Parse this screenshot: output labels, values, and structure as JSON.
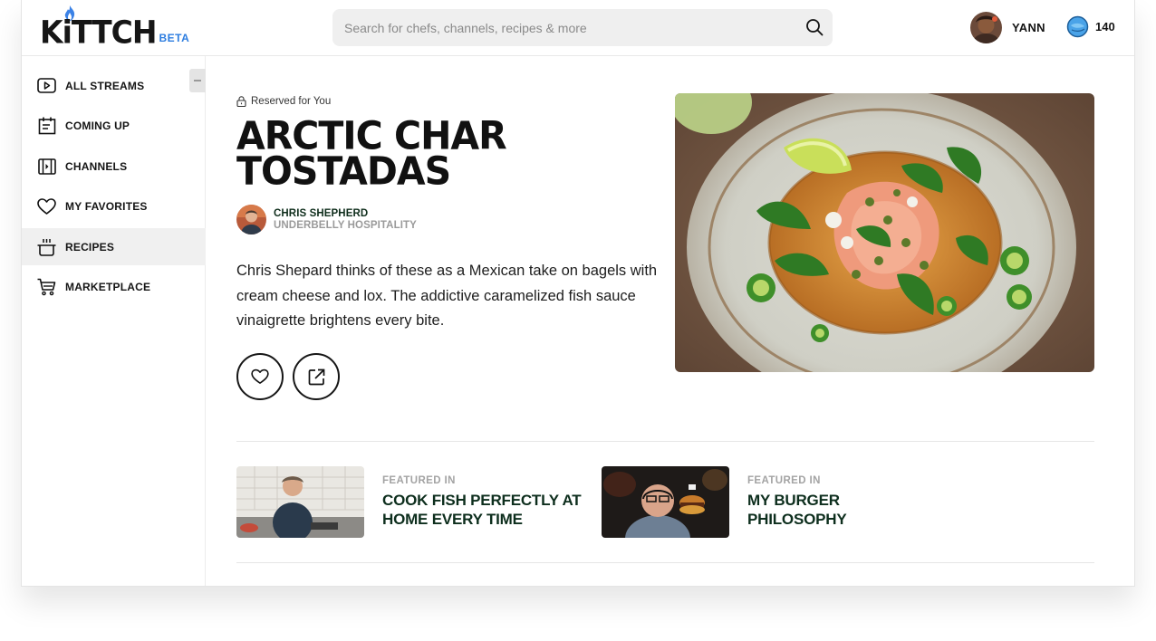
{
  "brand": {
    "name": "KiTTCH",
    "badge": "BETA"
  },
  "search": {
    "placeholder": "Search for chefs, channels, recipes & more",
    "icon": "search-icon"
  },
  "user": {
    "name": "YANN",
    "coins": "140"
  },
  "sidebar": {
    "items": [
      {
        "label": "ALL STREAMS",
        "icon": "play-icon",
        "active": false
      },
      {
        "label": "COMING UP",
        "icon": "calendar-icon",
        "active": false
      },
      {
        "label": "CHANNELS",
        "icon": "channels-icon",
        "active": false
      },
      {
        "label": "MY FAVORITES",
        "icon": "heart-icon",
        "active": false
      },
      {
        "label": "RECIPES",
        "icon": "pot-icon",
        "active": true
      },
      {
        "label": "MARKETPLACE",
        "icon": "cart-icon",
        "active": false
      }
    ]
  },
  "recipe": {
    "reserved": "Reserved for You",
    "title_lines": [
      "ARCTIC CHAR",
      "TOSTADAS"
    ],
    "chef_name": "CHRIS SHEPHERD",
    "chef_org": "UNDERBELLY HOSPITALITY",
    "description": "Chris Shepard thinks of these as a Mexican take on bagels with cream cheese and lox. The addictive caramelized fish sauce vinaigrette brightens every bite."
  },
  "featured": [
    {
      "kicker": "FEATURED IN",
      "title": "COOK FISH PERFECTLY AT HOME EVERY TIME"
    },
    {
      "kicker": "FEATURED IN",
      "title": "MY BURGER PHILOSOPHY"
    }
  ],
  "colors": {
    "accent_blue": "#2d7de0",
    "dark_green": "#0d2e1d",
    "muted_gray": "#9a9a9a"
  }
}
